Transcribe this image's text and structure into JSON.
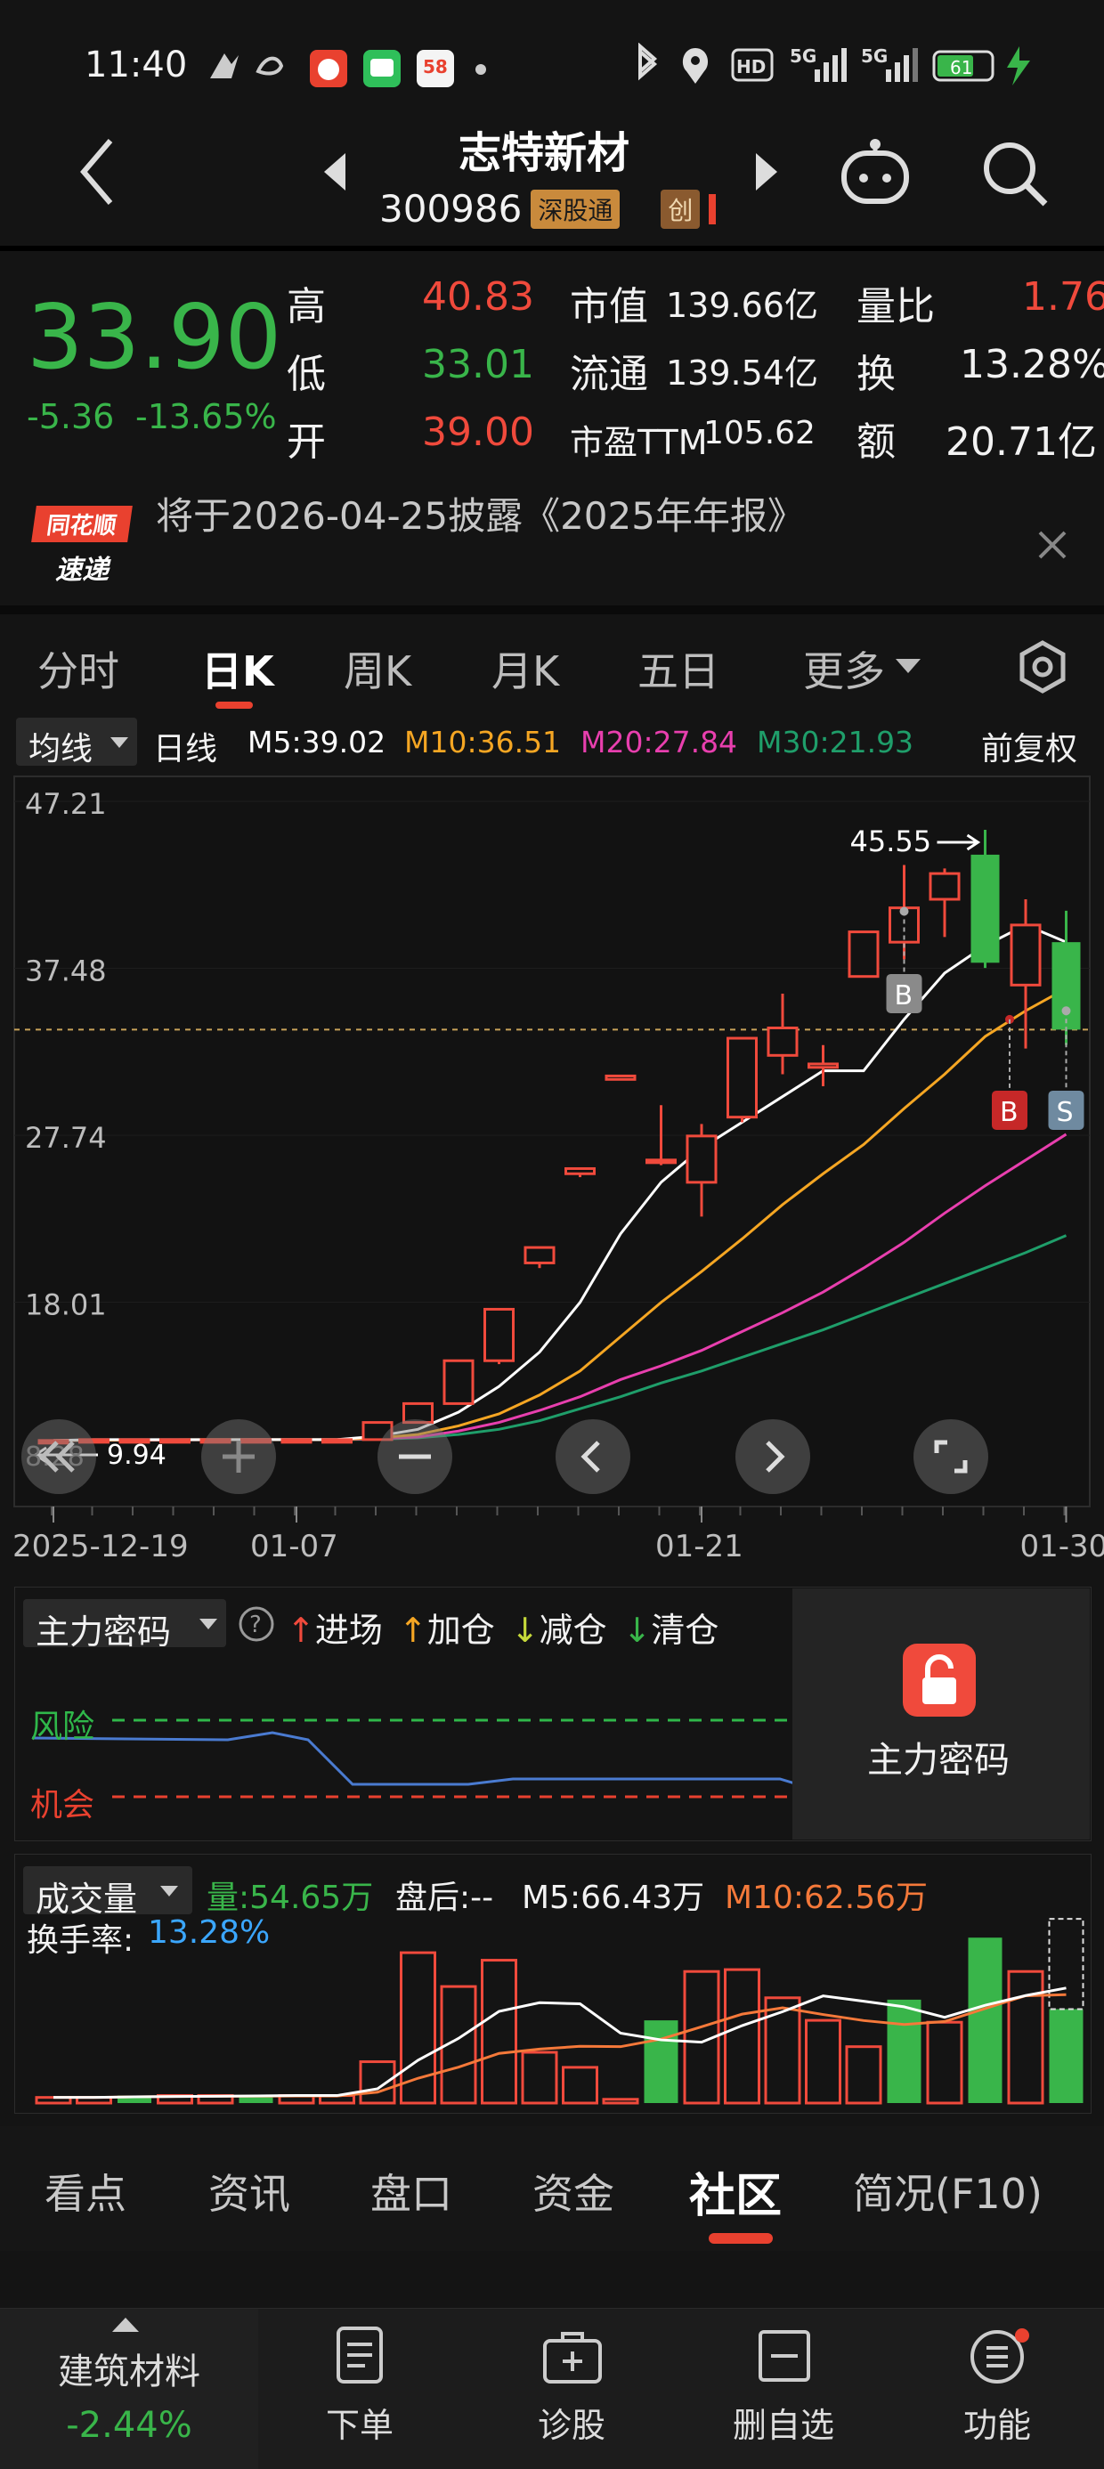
{
  "status_bar": {
    "time": "11:40",
    "network_labels": [
      "HD",
      "5G",
      "5G"
    ],
    "battery": "61"
  },
  "header": {
    "title": "志特新材",
    "code": "300986",
    "exchange_tag": "深股通",
    "board_tag": "创"
  },
  "quote": {
    "price": "33.90",
    "change": "-5.36",
    "change_pct": "-13.65%",
    "high_label": "高",
    "high_value": "40.83",
    "low_label": "低",
    "low_value": "33.01",
    "open_label": "开",
    "open_value": "39.00",
    "mktcap_label": "市值",
    "mktcap_value": "139.66亿",
    "float_label": "流通",
    "float_value": "139.54亿",
    "pe_label": "市盈TTM",
    "pe_value": "105.62",
    "volratio_label": "量比",
    "volratio_value": "1.76",
    "turnover_label": "换",
    "turnover_value": "13.28%",
    "amount_label": "额",
    "amount_value": "20.71亿",
    "colors": {
      "up": "#f04a3c",
      "down": "#39b54a"
    }
  },
  "notice": {
    "badge_top": "同花顺",
    "badge_bottom": "速递",
    "text": "将于2026-04-25披露《2025年年报》"
  },
  "kline_tabs": {
    "items": [
      "分时",
      "日K",
      "周K",
      "月K",
      "五日",
      "更多"
    ],
    "active": "日K"
  },
  "ma_bar": {
    "selector": "均线",
    "period": "日线",
    "m5": "M5:39.02",
    "m10": "M10:36.51",
    "m20": "M20:27.84",
    "m30": "M30:21.93",
    "adjust": "前复权",
    "colors": {
      "m5": "#ffffff",
      "m10": "#f5a623",
      "m20": "#e83fae",
      "m30": "#1f9e6a"
    }
  },
  "chart_data": {
    "type": "candlestick",
    "yticks": [
      "47.21",
      "37.48",
      "27.74",
      "18.01"
    ],
    "y_min_label": "8.28",
    "ylim": [
      8.28,
      47.21
    ],
    "xticks": [
      "2025-12-19",
      "01-07",
      "01-21",
      "01-30"
    ],
    "annotations": {
      "max": "45.55",
      "min": "9.94",
      "buy": "B",
      "sell": "S"
    },
    "candles": [
      {
        "o": 9.9,
        "c": 9.95,
        "h": 10.0,
        "l": 9.94
      },
      {
        "o": 9.95,
        "c": 10.0,
        "h": 10.05,
        "l": 9.94
      },
      {
        "o": 10.0,
        "c": 10.0,
        "h": 10.05,
        "l": 9.95
      },
      {
        "o": 10.0,
        "c": 10.0,
        "h": 10.05,
        "l": 9.95
      },
      {
        "o": 10.0,
        "c": 10.0,
        "h": 10.05,
        "l": 9.95
      },
      {
        "o": 10.0,
        "c": 10.0,
        "h": 10.05,
        "l": 9.95
      },
      {
        "o": 10.0,
        "c": 10.0,
        "h": 10.05,
        "l": 9.95
      },
      {
        "o": 10.0,
        "c": 10.0,
        "h": 10.05,
        "l": 9.95
      },
      {
        "o": 10.0,
        "c": 11.0,
        "h": 11.0,
        "l": 9.95
      },
      {
        "o": 11.0,
        "c": 12.1,
        "h": 12.1,
        "l": 11.0
      },
      {
        "o": 12.1,
        "c": 14.6,
        "h": 14.6,
        "l": 12.1
      },
      {
        "o": 14.6,
        "c": 17.6,
        "h": 17.6,
        "l": 14.4
      },
      {
        "o": 20.3,
        "c": 21.2,
        "h": 21.2,
        "l": 20.0
      },
      {
        "o": 25.5,
        "c": 25.8,
        "h": 25.8,
        "l": 25.3
      },
      {
        "o": 31.0,
        "c": 31.2,
        "h": 31.2,
        "l": 31.0
      },
      {
        "o": 26.2,
        "c": 26.3,
        "h": 29.5,
        "l": 26.0
      },
      {
        "o": 25.0,
        "c": 27.7,
        "h": 28.4,
        "l": 23.0
      },
      {
        "o": 28.8,
        "c": 33.4,
        "h": 33.4,
        "l": 28.5
      },
      {
        "o": 32.4,
        "c": 34.0,
        "h": 36.0,
        "l": 31.3
      },
      {
        "o": 31.7,
        "c": 31.9,
        "h": 33.0,
        "l": 30.6
      },
      {
        "o": 37.0,
        "c": 39.6,
        "h": 39.6,
        "l": 37.0
      },
      {
        "o": 39.0,
        "c": 41.0,
        "h": 43.5,
        "l": 38.0
      },
      {
        "o": 41.5,
        "c": 43.0,
        "h": 43.3,
        "l": 39.3
      },
      {
        "o": 44.1,
        "c": 37.8,
        "h": 45.55,
        "l": 37.5
      },
      {
        "o": 36.5,
        "c": 40.0,
        "h": 41.5,
        "l": 32.8
      },
      {
        "o": 39.0,
        "c": 33.9,
        "h": 40.83,
        "l": 33.01
      }
    ],
    "ma": {
      "m5": [
        9.95,
        10.0,
        10.0,
        10.0,
        10.0,
        10.0,
        10.0,
        10.0,
        10.2,
        10.6,
        11.6,
        13.1,
        15.1,
        18.0,
        22.0,
        25.0,
        27.0,
        28.5,
        30.0,
        31.5,
        31.5,
        34.5,
        37.2,
        38.8,
        40.0,
        39.0
      ],
      "m10": [
        9.95,
        9.97,
        9.98,
        9.99,
        10.0,
        10.0,
        10.0,
        10.0,
        10.1,
        10.3,
        10.8,
        11.5,
        12.6,
        14.0,
        16.0,
        18.0,
        19.8,
        21.7,
        23.7,
        25.5,
        27.2,
        29.3,
        31.3,
        33.5,
        35.0,
        36.3
      ],
      "m20": [
        9.95,
        9.96,
        9.97,
        9.98,
        9.99,
        10.0,
        10.0,
        10.0,
        10.05,
        10.15,
        10.5,
        11.0,
        11.7,
        12.5,
        13.5,
        14.3,
        15.2,
        16.3,
        17.4,
        18.6,
        20.0,
        21.5,
        23.2,
        24.8,
        26.3,
        27.8
      ],
      "m30": [
        9.95,
        9.96,
        9.97,
        9.98,
        9.99,
        10.0,
        10.0,
        10.0,
        10.02,
        10.1,
        10.3,
        10.6,
        11.1,
        11.8,
        12.5,
        13.3,
        14.0,
        14.8,
        15.6,
        16.4,
        17.3,
        18.2,
        19.1,
        20.0,
        20.9,
        21.9
      ]
    }
  },
  "secret_panel": {
    "title": "主力密码",
    "legend": [
      "进场",
      "加仓",
      "减仓",
      "清仓"
    ],
    "risk_label": "风险",
    "chance_label": "机会",
    "lock_label": "主力密码"
  },
  "volume_panel": {
    "title": "成交量",
    "vol": "量:54.65万",
    "after_hours": "盘后:--",
    "m5": "M5:66.43万",
    "m10": "M10:62.56万",
    "turnover_label": "换手率:",
    "turnover_value": "13.28%",
    "bars": [
      {
        "v": 3,
        "c": "r"
      },
      {
        "v": 3,
        "c": "r"
      },
      {
        "v": 4,
        "c": "g"
      },
      {
        "v": 4,
        "c": "r"
      },
      {
        "v": 4,
        "c": "r"
      },
      {
        "v": 4,
        "c": "g"
      },
      {
        "v": 4,
        "c": "r"
      },
      {
        "v": 4,
        "c": "r"
      },
      {
        "v": 22,
        "c": "r"
      },
      {
        "v": 80,
        "c": "r"
      },
      {
        "v": 62,
        "c": "r"
      },
      {
        "v": 76,
        "c": "r"
      },
      {
        "v": 27,
        "c": "r"
      },
      {
        "v": 19,
        "c": "r"
      },
      {
        "v": 2,
        "c": "r"
      },
      {
        "v": 44,
        "c": "g"
      },
      {
        "v": 70,
        "c": "r"
      },
      {
        "v": 71,
        "c": "r"
      },
      {
        "v": 56,
        "c": "r"
      },
      {
        "v": 44,
        "c": "r"
      },
      {
        "v": 30,
        "c": "r"
      },
      {
        "v": 55,
        "c": "g"
      },
      {
        "v": 43,
        "c": "r"
      },
      {
        "v": 88,
        "c": "g"
      },
      {
        "v": 70,
        "c": "r"
      },
      {
        "v": 50,
        "c": "g"
      }
    ]
  },
  "section_tabs": {
    "items": [
      "看点",
      "资讯",
      "盘口",
      "资金",
      "社区",
      "简况(F10)"
    ],
    "active": "社区"
  },
  "bottom_bar": {
    "sector_name": "建筑材料",
    "sector_change": "-2.44%",
    "items": [
      "下单",
      "诊股",
      "删自选",
      "功能"
    ]
  }
}
